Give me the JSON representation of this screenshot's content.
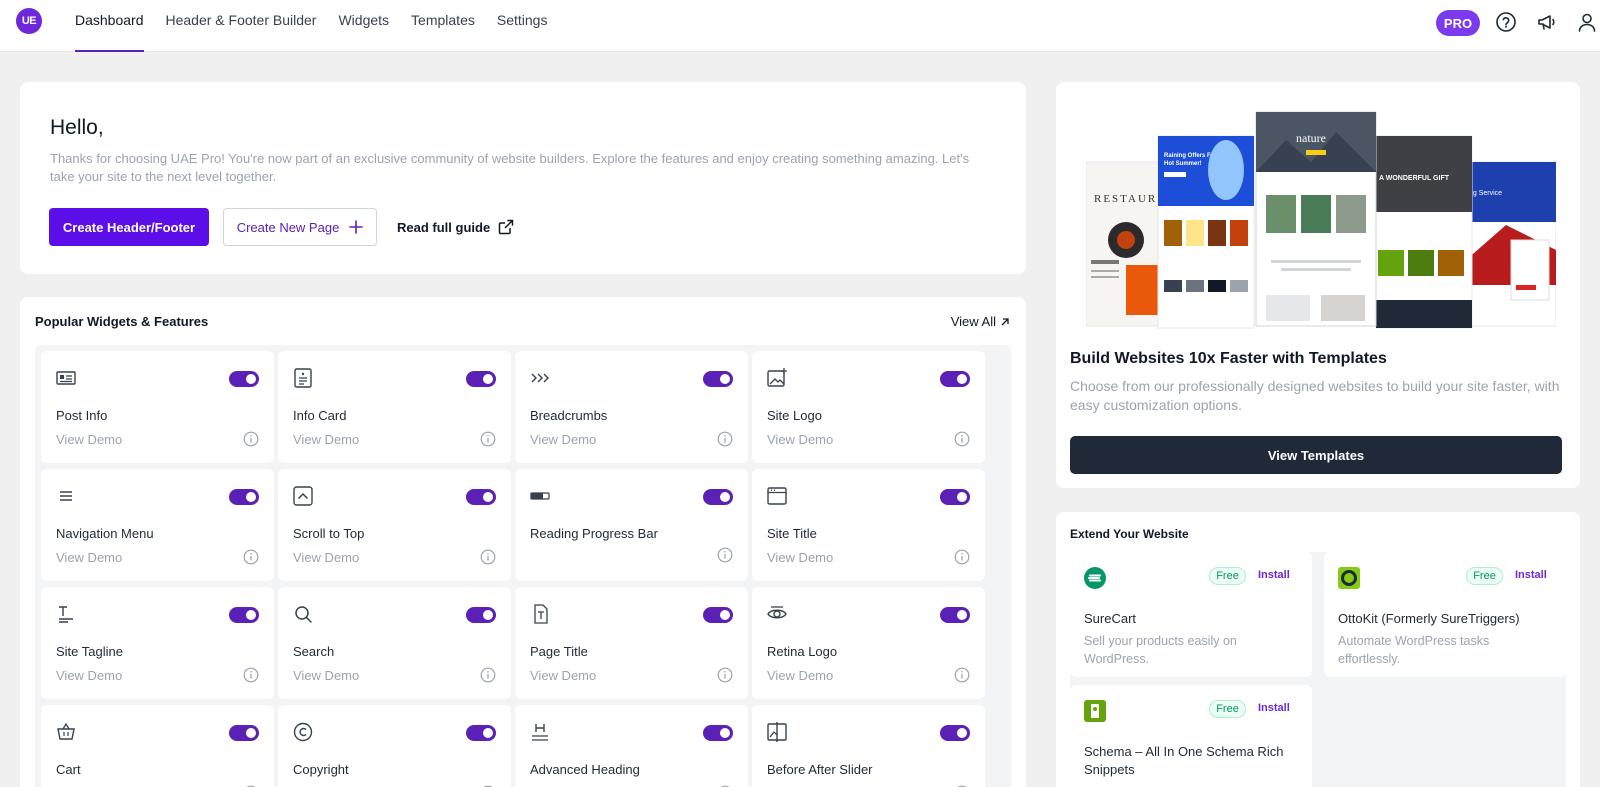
{
  "nav": {
    "logo_text": "UE",
    "items": [
      "Dashboard",
      "Header & Footer Builder",
      "Widgets",
      "Templates",
      "Settings"
    ],
    "active_index": 0,
    "pro_label": "PRO"
  },
  "hello": {
    "title": "Hello,",
    "text": "Thanks for choosing UAE Pro! You're now part of an exclusive community of website builders. Explore the features and enjoy creating something amazing. Let's take your site to the next level together.",
    "create_header_footer": "Create Header/Footer",
    "create_new_page": "Create New Page",
    "read_guide": "Read full guide"
  },
  "widgets": {
    "title": "Popular Widgets & Features",
    "view_all": "View All",
    "view_demo": "View Demo",
    "items": [
      {
        "name": "Post Info",
        "icon": "post-info-icon",
        "demo": true,
        "enabled": true
      },
      {
        "name": "Info Card",
        "icon": "info-card-icon",
        "demo": true,
        "enabled": true
      },
      {
        "name": "Breadcrumbs",
        "icon": "breadcrumbs-icon",
        "demo": true,
        "enabled": true
      },
      {
        "name": "Site Logo",
        "icon": "site-logo-icon",
        "demo": true,
        "enabled": true
      },
      {
        "name": "Navigation Menu",
        "icon": "menu-icon",
        "demo": true,
        "enabled": true
      },
      {
        "name": "Scroll to Top",
        "icon": "scroll-top-icon",
        "demo": true,
        "enabled": true
      },
      {
        "name": "Reading Progress Bar",
        "icon": "progress-bar-icon",
        "demo": false,
        "enabled": true
      },
      {
        "name": "Site Title",
        "icon": "site-title-icon",
        "demo": true,
        "enabled": true
      },
      {
        "name": "Site Tagline",
        "icon": "tagline-icon",
        "demo": true,
        "enabled": true
      },
      {
        "name": "Search",
        "icon": "search-icon",
        "demo": true,
        "enabled": true
      },
      {
        "name": "Page Title",
        "icon": "page-title-icon",
        "demo": true,
        "enabled": true
      },
      {
        "name": "Retina Logo",
        "icon": "eye-icon",
        "demo": true,
        "enabled": true
      },
      {
        "name": "Cart",
        "icon": "cart-icon",
        "demo": true,
        "enabled": true
      },
      {
        "name": "Copyright",
        "icon": "copyright-icon",
        "demo": true,
        "enabled": true
      },
      {
        "name": "Advanced Heading",
        "icon": "heading-icon",
        "demo": true,
        "enabled": true
      },
      {
        "name": "Before After Slider",
        "icon": "before-after-icon",
        "demo": true,
        "enabled": true
      }
    ]
  },
  "templates": {
    "preview_words": [
      "RESTAUR",
      "Raining Offers For Hot Summer!",
      "nature",
      "A WONDERFUL GIFT",
      "ng Service"
    ],
    "title": "Build Websites 10x Faster with Templates",
    "text": "Choose from our professionally designed websites to build your site faster, with easy customization options.",
    "button": "View Templates"
  },
  "extend": {
    "title": "Extend Your Website",
    "free_label": "Free",
    "install_label": "Install",
    "plugins": [
      {
        "name": "SureCart",
        "desc": "Sell your products easily on WordPress.",
        "icon": "surecart-icon",
        "color": "#059669"
      },
      {
        "name": "OttoKit (Formerly SureTriggers)",
        "desc": "Automate WordPress tasks effortlessly.",
        "icon": "ottokit-icon",
        "color": "#84cc16"
      },
      {
        "name": "Schema – All In One Schema Rich Snippets",
        "desc": "",
        "icon": "schema-icon",
        "color": "#65a30d"
      }
    ]
  },
  "colors": {
    "brand": "#5b0ee8",
    "accent": "#5b21b6",
    "dark": "#1f2937"
  }
}
